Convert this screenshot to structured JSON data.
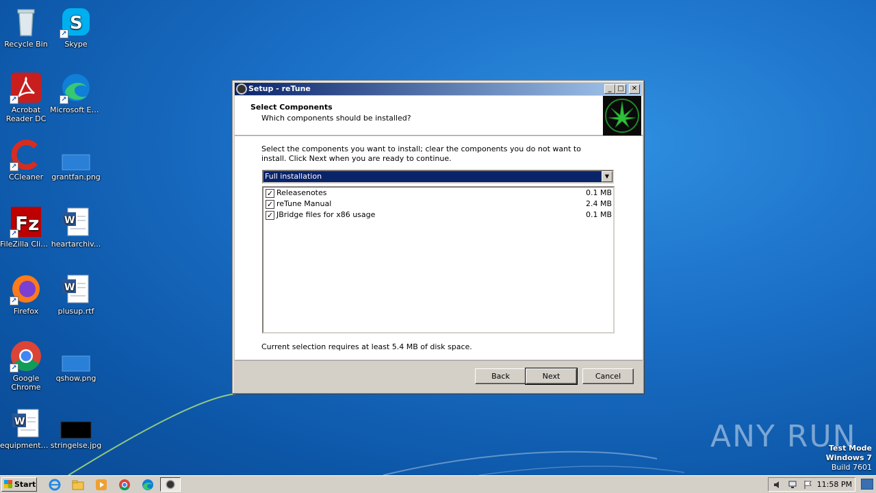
{
  "desktop": {
    "icons": [
      {
        "label": "Recycle Bin",
        "icon": "recycle-bin-icon"
      },
      {
        "label": "Skype",
        "icon": "skype-icon"
      },
      {
        "label": "Acrobat Reader DC",
        "icon": "acrobat-icon"
      },
      {
        "label": "Microsoft Edge",
        "icon": "edge-icon"
      },
      {
        "label": "CCleaner",
        "icon": "ccleaner-icon"
      },
      {
        "label": "grantfan.png",
        "icon": "image-file-icon"
      },
      {
        "label": "FileZilla Client",
        "icon": "filezilla-icon"
      },
      {
        "label": "heartarchiv...",
        "icon": "word-doc-icon"
      },
      {
        "label": "Firefox",
        "icon": "firefox-icon"
      },
      {
        "label": "plusup.rtf",
        "icon": "word-doc-icon"
      },
      {
        "label": "Google Chrome",
        "icon": "chrome-icon"
      },
      {
        "label": "qshow.png",
        "icon": "image-file-icon"
      },
      {
        "label": "equipmente...",
        "icon": "word-doc-icon"
      },
      {
        "label": "stringelse.jpg",
        "icon": "image-file-icon"
      }
    ],
    "watermark": "ANY RUN",
    "test_mode": {
      "line1": "Test Mode",
      "line2": "Windows 7",
      "line3": "Build 7601"
    }
  },
  "window": {
    "title": "Setup - reTune",
    "header_title": "Select Components",
    "header_subtitle": "Which components should be installed?",
    "instructions": "Select the components you want to install; clear the components you do not want to install. Click Next when you are ready to continue.",
    "install_type": "Full installation",
    "components": [
      {
        "name": "Releasenotes",
        "size": "0.1 MB",
        "checked": true
      },
      {
        "name": "reTune Manual",
        "size": "2.4 MB",
        "checked": true
      },
      {
        "name": "JBridge files for x86 usage",
        "size": "0.1 MB",
        "checked": true
      }
    ],
    "disk_requirement": "Current selection requires at least 5.4 MB of disk space.",
    "buttons": {
      "back": "Back",
      "next": "Next",
      "cancel": "Cancel"
    }
  },
  "taskbar": {
    "start_label": "Start",
    "pinned": [
      "ie-icon",
      "explorer-icon",
      "media-player-icon",
      "chrome-icon",
      "edge-icon",
      "setup-app-icon"
    ],
    "clock": "11:58 PM"
  }
}
